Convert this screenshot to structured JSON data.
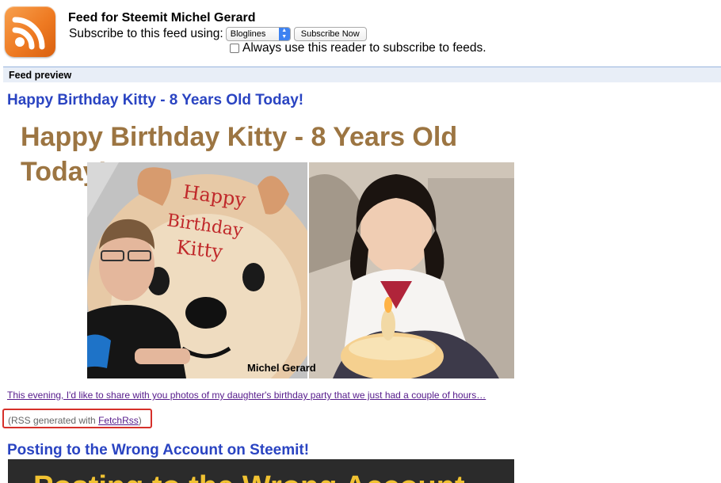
{
  "header": {
    "title": "Feed for Steemit Michel Gerard",
    "subscribe_label": "Subscribe to this feed using:",
    "reader_selected": "Bloglines",
    "subscribe_button": "Subscribe Now",
    "always_label": "Always use this reader to subscribe to feeds.",
    "always_checked": false
  },
  "preview": {
    "label": "Feed preview"
  },
  "entries": [
    {
      "title": "Happy Birthday Kitty - 8 Years Old Today!",
      "image_heading": "Happy Birthday Kitty - 8 Years Old Today!",
      "image_watermark": "Michel Gerard",
      "summary": "This evening, I'd like to share with you photos of my daughter's birthday party that we just had a couple of hours…",
      "rss_note_prefix": "(RSS generated with ",
      "rss_note_link": "FetchRss",
      "rss_note_suffix": ")"
    },
    {
      "title": "Posting to the Wrong Account on Steemit!",
      "image_heading": "Posting to the Wrong Account"
    }
  ],
  "colors": {
    "link_title": "#2a44c2",
    "heading_gold": "#9c7542",
    "highlight_box": "#d6302a",
    "rss_orange": "#ee7a22"
  }
}
